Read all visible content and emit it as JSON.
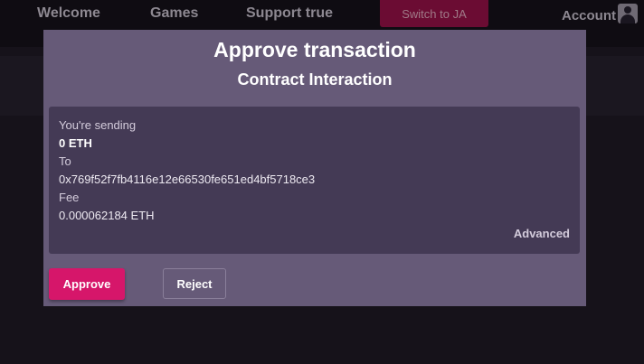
{
  "background_app": {
    "nav": {
      "welcome": "Welcome",
      "games": "Games",
      "support": "Support true"
    },
    "switch_button": "Switch to JA",
    "account_label": "Account",
    "account_icon": "user-avatar-icon"
  },
  "modal": {
    "title": "Approve transaction",
    "subtitle": "Contract Interaction",
    "details": {
      "sending_label": "You're sending",
      "amount": "0 ETH",
      "to_label": "To",
      "to_address": "0x769f52f7fb4116e12e66530fe651ed4bf5718ce3",
      "fee_label": "Fee",
      "fee_value": "0.000062184 ETH",
      "advanced_link": "Advanced"
    },
    "buttons": {
      "approve": "Approve",
      "reject": "Reject"
    }
  },
  "colors": {
    "accent": "#d6166a",
    "modal_bg": "#665a78",
    "details_bg": "#443a55"
  }
}
